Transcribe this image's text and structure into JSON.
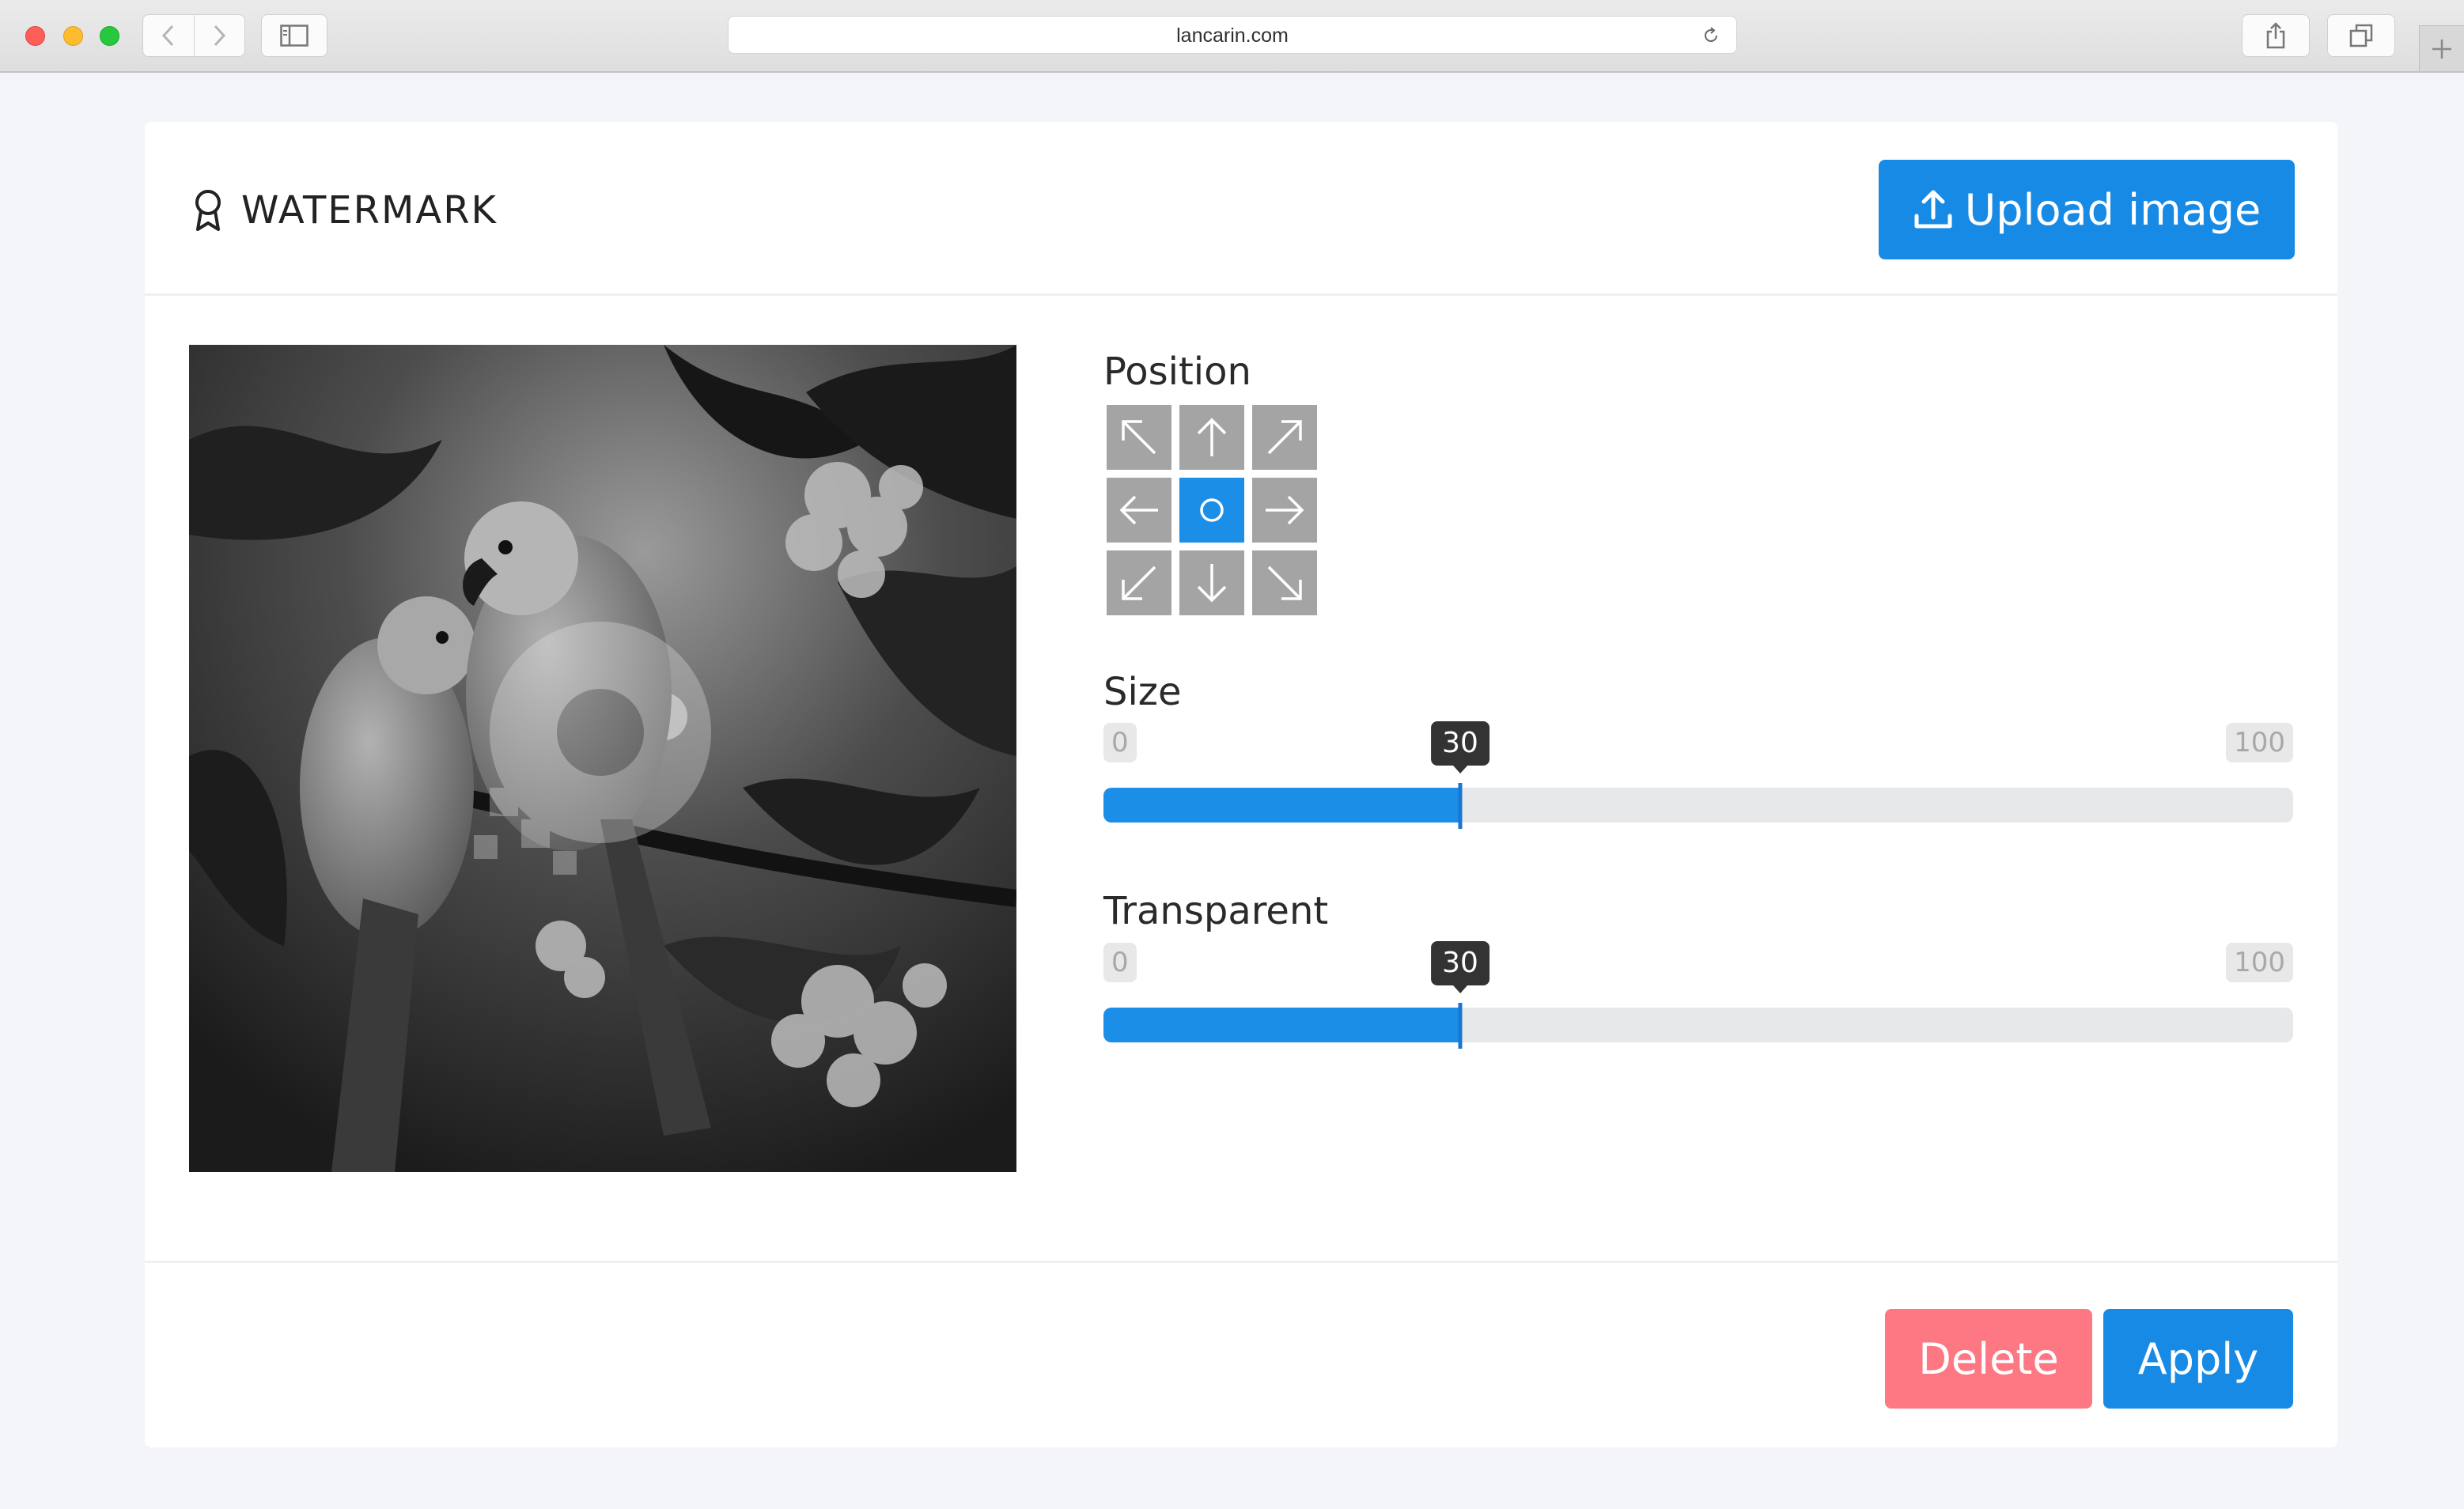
{
  "browser": {
    "url": "lancarin.com"
  },
  "header": {
    "title": "WATERMARK",
    "upload_label": "Upload image"
  },
  "position": {
    "label": "Position",
    "cells": [
      "top-left",
      "top",
      "top-right",
      "left",
      "center",
      "right",
      "bottom-left",
      "bottom",
      "bottom-right"
    ],
    "selected": "center"
  },
  "size": {
    "label": "Size",
    "min": "0",
    "max": "100",
    "value": "30",
    "fraction": 0.3
  },
  "transparent": {
    "label": "Transparent",
    "min": "0",
    "max": "100",
    "value": "30",
    "fraction": 0.3
  },
  "footer": {
    "delete_label": "Delete",
    "apply_label": "Apply"
  },
  "colors": {
    "primary": "#178ae6",
    "danger": "#fd7883"
  }
}
